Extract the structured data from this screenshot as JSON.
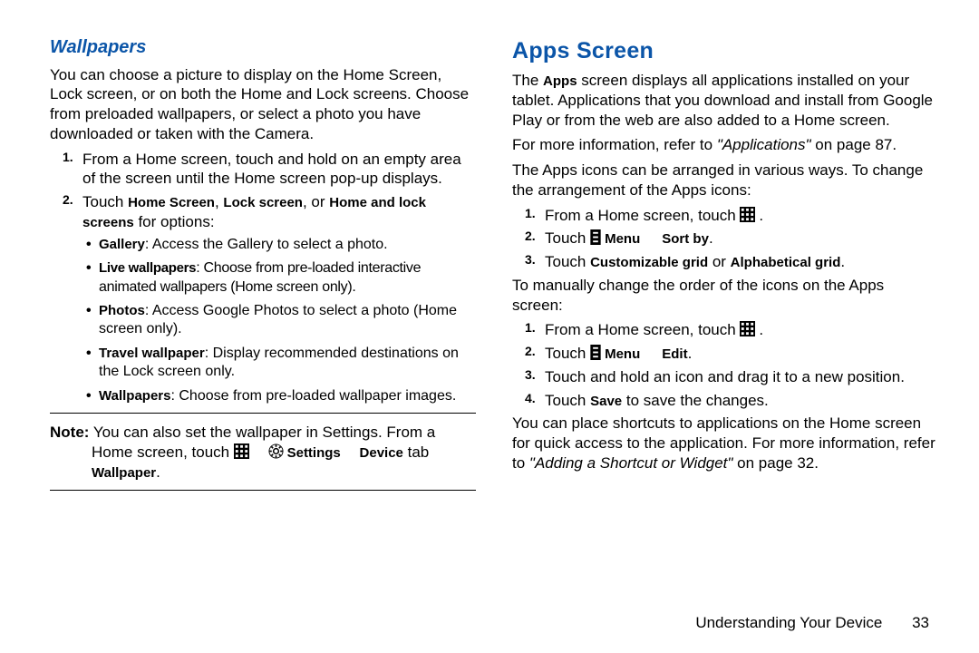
{
  "left": {
    "heading": "Wallpapers",
    "intro": "You can choose a picture to display on the Home Screen, Lock screen, or on both the Home and Lock screens. Choose from preloaded wallpapers, or select a photo you have downloaded or taken with the Camera.",
    "step1": "From a Home screen, touch and hold on an empty area of the screen until the Home screen pop-up displays.",
    "step2_pre": "Touch ",
    "step2_b1": "Home Screen",
    "step2_sep1": ", ",
    "step2_b2": "Lock screen",
    "step2_sep2": ", or ",
    "step2_b3": "Home and lock screens",
    "step2_post": " for options:",
    "bullets": {
      "gallery_b": "Gallery",
      "gallery_t": ": Access the Gallery to select a photo.",
      "live_b": "Live wallpapers",
      "live_t": ": Choose from pre-loaded interactive animated wallpapers (Home screen only).",
      "photos_b": "Photos",
      "photos_t": ": Access Google Photos to select a photo (Home screen only).",
      "travel_b": "Travel wallpaper",
      "travel_t": ": Display recommended destinations on the Lock screen only.",
      "wp_b": "Wallpapers",
      "wp_t": ": Choose from pre-loaded wallpaper images."
    },
    "note_label": "Note:",
    "note_line1": " You can also set the wallpaper in Settings. From a",
    "note_line2_pre": "Home screen, touch ",
    "note_settings": "Settings",
    "note_device": "Device",
    "note_tab": " tab ",
    "note_wallpaper": "Wallpaper",
    "note_period": "."
  },
  "right": {
    "heading": "Apps Screen",
    "p1_pre": "The ",
    "p1_apps": "Apps",
    "p1_post": " screen displays all applications installed on your tablet. Applications that you download and install from Google Play or from the web are also added to a Home screen.",
    "p2_pre": "For more information, refer to ",
    "p2_it": "\"Applications\"",
    "p2_post": " on page 87.",
    "p3": "The Apps icons can be arranged in various ways. To change the arrangement of the Apps icons:",
    "a1_pre": "From a Home screen, touch ",
    "a1_post": ".",
    "a2_pre": "Touch ",
    "a2_menu": "Menu",
    "a2_sortby": "Sort by",
    "a2_post": ".",
    "a3_pre": "Touch ",
    "a3_cg": "Customizable grid",
    "a3_or": " or ",
    "a3_ag": "Alphabetical grid",
    "a3_post": ".",
    "p4": "To manually change the order of the icons on the Apps screen:",
    "b1_pre": "From a Home screen, touch ",
    "b1_post": ".",
    "b2_pre": "Touch ",
    "b2_menu": "Menu",
    "b2_edit": "Edit",
    "b2_post": ".",
    "b3": "Touch and hold an icon and drag it to a new position.",
    "b4_pre": "Touch ",
    "b4_save": "Save",
    "b4_post": " to save the changes.",
    "p5_pre": "You can place shortcuts to applications on the Home screen for quick access to the application. For more information, refer to ",
    "p5_it": "\"Adding a Shortcut or Widget\"",
    "p5_post": " on page 32."
  },
  "footer": {
    "section": "Understanding Your Device",
    "page": "33"
  }
}
